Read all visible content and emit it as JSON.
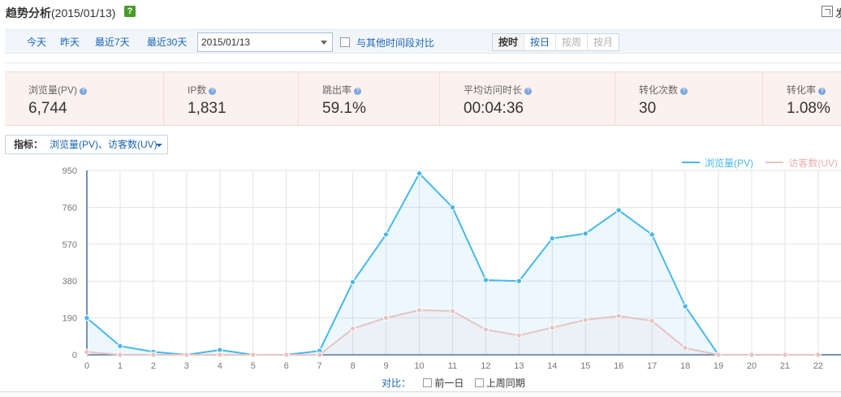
{
  "header": {
    "title": "趋势分析",
    "date": "(2015/01/13)",
    "help": "?",
    "export_label": "发"
  },
  "toolbar": {
    "tabs": [
      "今天",
      "昨天",
      "最近7天",
      "最近30天"
    ],
    "active_tab": "今天",
    "date_value": "2015/01/13",
    "compare_label": "与其他时间段对比",
    "granularity": [
      "按时",
      "按日",
      "按周",
      "按月"
    ],
    "active_granularity": "按时"
  },
  "metrics": [
    {
      "label": "浏览量(PV)",
      "value": "6,744"
    },
    {
      "label": "IP数",
      "value": "1,831"
    },
    {
      "label": "跳出率",
      "value": "59.1%"
    },
    {
      "label": "平均访问时长",
      "value": "00:04:36"
    },
    {
      "label": "转化次数",
      "value": "30"
    },
    {
      "label": "转化率",
      "value": "1.08%"
    }
  ],
  "indicator": {
    "label": "指标：",
    "value": "浏览量(PV)、访客数(UV)"
  },
  "compare": {
    "label": "对比：",
    "options": [
      "前一日",
      "上周同期"
    ]
  },
  "colors": {
    "pv": "#47b8ea",
    "uv": "#e8c3c3",
    "accent": "#4b9de8"
  },
  "chart_data": {
    "type": "area",
    "x": [
      0,
      1,
      2,
      3,
      4,
      5,
      6,
      7,
      8,
      9,
      10,
      11,
      12,
      13,
      14,
      15,
      16,
      17,
      18,
      19,
      20,
      21,
      22
    ],
    "ylim": [
      0,
      950
    ],
    "yticks": [
      0,
      190,
      380,
      570,
      760,
      950
    ],
    "grid": true,
    "legend": "top-right",
    "series": [
      {
        "name": "浏览量(PV)",
        "values": [
          190,
          45,
          15,
          0,
          25,
          0,
          0,
          20,
          375,
          620,
          935,
          760,
          385,
          380,
          600,
          625,
          745,
          620,
          250,
          -20,
          -20,
          -20,
          -20
        ]
      },
      {
        "name": "访客数(UV)",
        "values": [
          15,
          -5,
          -10,
          -15,
          -10,
          -15,
          -15,
          -10,
          135,
          190,
          230,
          225,
          130,
          100,
          140,
          180,
          200,
          175,
          35,
          -20,
          -20,
          -20,
          -20
        ]
      }
    ]
  }
}
